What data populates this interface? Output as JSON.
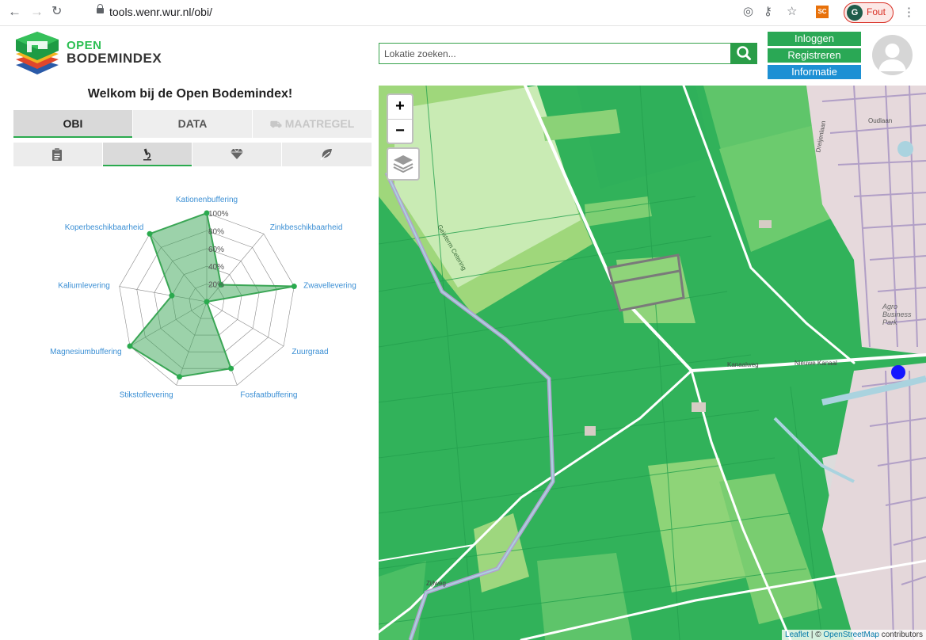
{
  "browser": {
    "url": "tools.wenr.wur.nl/obi/",
    "ext_label": "SC",
    "profile_initial": "G",
    "profile_status": "Fout"
  },
  "header": {
    "brand_line1": "OPEN",
    "brand_line2": "BODEMINDEX",
    "search_placeholder": "Lokatie zoeken...",
    "auth": {
      "login": "Inloggen",
      "register": "Registreren",
      "info": "Informatie"
    }
  },
  "panel": {
    "welcome": "Welkom bij de Open Bodemindex!",
    "tabs": [
      {
        "label": "OBI",
        "active": true
      },
      {
        "label": "DATA",
        "active": false
      },
      {
        "label": "MAATREGEL",
        "active": false
      }
    ],
    "subtabs": [
      {
        "icon": "clipboard-icon",
        "active": false
      },
      {
        "icon": "microscope-icon",
        "active": true
      },
      {
        "icon": "diamond-icon",
        "active": false
      },
      {
        "icon": "leaf-icon",
        "active": false
      }
    ]
  },
  "chart_data": {
    "type": "radar",
    "categories": [
      "Kationenbuffering",
      "Zinkbeschikbaarheid",
      "Zwavellevering",
      "Zuurgraad",
      "Fosfaatbuffering",
      "Stikstoflevering",
      "Magnesiumbuffering",
      "Kaliumlevering",
      "Koperbeschikbaarheid"
    ],
    "values": [
      100,
      25,
      100,
      0,
      80,
      90,
      100,
      40,
      100
    ],
    "tick_labels": [
      "20%",
      "40%",
      "60%",
      "80%",
      "100%"
    ],
    "rlim": [
      0,
      100
    ],
    "colors": {
      "fill": "#3aa655",
      "point": "#2aaa4e",
      "grid": "#555555",
      "label": "#3b8fd4"
    }
  },
  "map": {
    "zoom_in": "+",
    "zoom_out": "−",
    "attribution_leaflet": "Leaflet",
    "attribution_sep": " | © ",
    "attribution_osm": "OpenStreetMap",
    "attribution_tail": " contributors",
    "labels": [
      {
        "text": "Geisterm Cetering"
      },
      {
        "text": "Kanaalweg"
      },
      {
        "text": "Nieuwe Kanaal"
      },
      {
        "text": "Agro Business Park"
      },
      {
        "text": "Zijlweg"
      },
      {
        "text": "Dreijenlaan"
      },
      {
        "text": "Oudlaan"
      }
    ]
  }
}
